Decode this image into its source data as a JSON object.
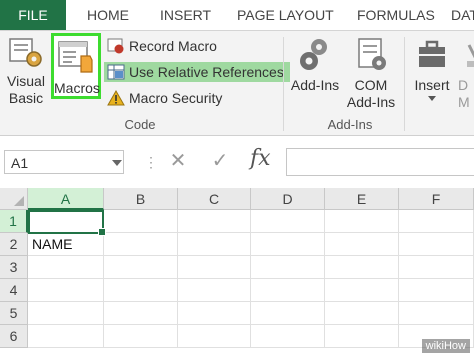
{
  "tabs": {
    "file": "FILE",
    "home": "HOME",
    "insert": "INSERT",
    "page_layout": "PAGE LAYOUT",
    "formulas": "FORMULAS",
    "data": "DATA"
  },
  "ribbon": {
    "code_group": {
      "label": "Code",
      "visual_basic": [
        "Visual",
        "Basic"
      ],
      "macros": "Macros",
      "record_macro": "Record Macro",
      "use_relative_references": "Use Relative References",
      "macro_security": "Macro Security"
    },
    "addins_group": {
      "label": "Add-Ins",
      "addins": "Add-Ins",
      "com_addins": [
        "COM",
        "Add-Ins"
      ]
    },
    "controls": {
      "insert": "Insert",
      "design_mode_partial": [
        "D",
        "M"
      ]
    },
    "accent_color": "#217346",
    "highlight_color": "#9fd9a0",
    "macros_outline_color": "#3ddc2f"
  },
  "formula_bar": {
    "name_box": "A1",
    "fx": "fx",
    "cancel_icon": "close-icon",
    "enter_icon": "check-icon",
    "value": ""
  },
  "grid": {
    "columns": [
      "A",
      "B",
      "C",
      "D",
      "E",
      "F"
    ],
    "rows": [
      "1",
      "2",
      "3",
      "4",
      "5",
      "6"
    ],
    "active_cell": "A1",
    "cells": {
      "A2": "NAME"
    }
  },
  "watermark": "wikiHow"
}
